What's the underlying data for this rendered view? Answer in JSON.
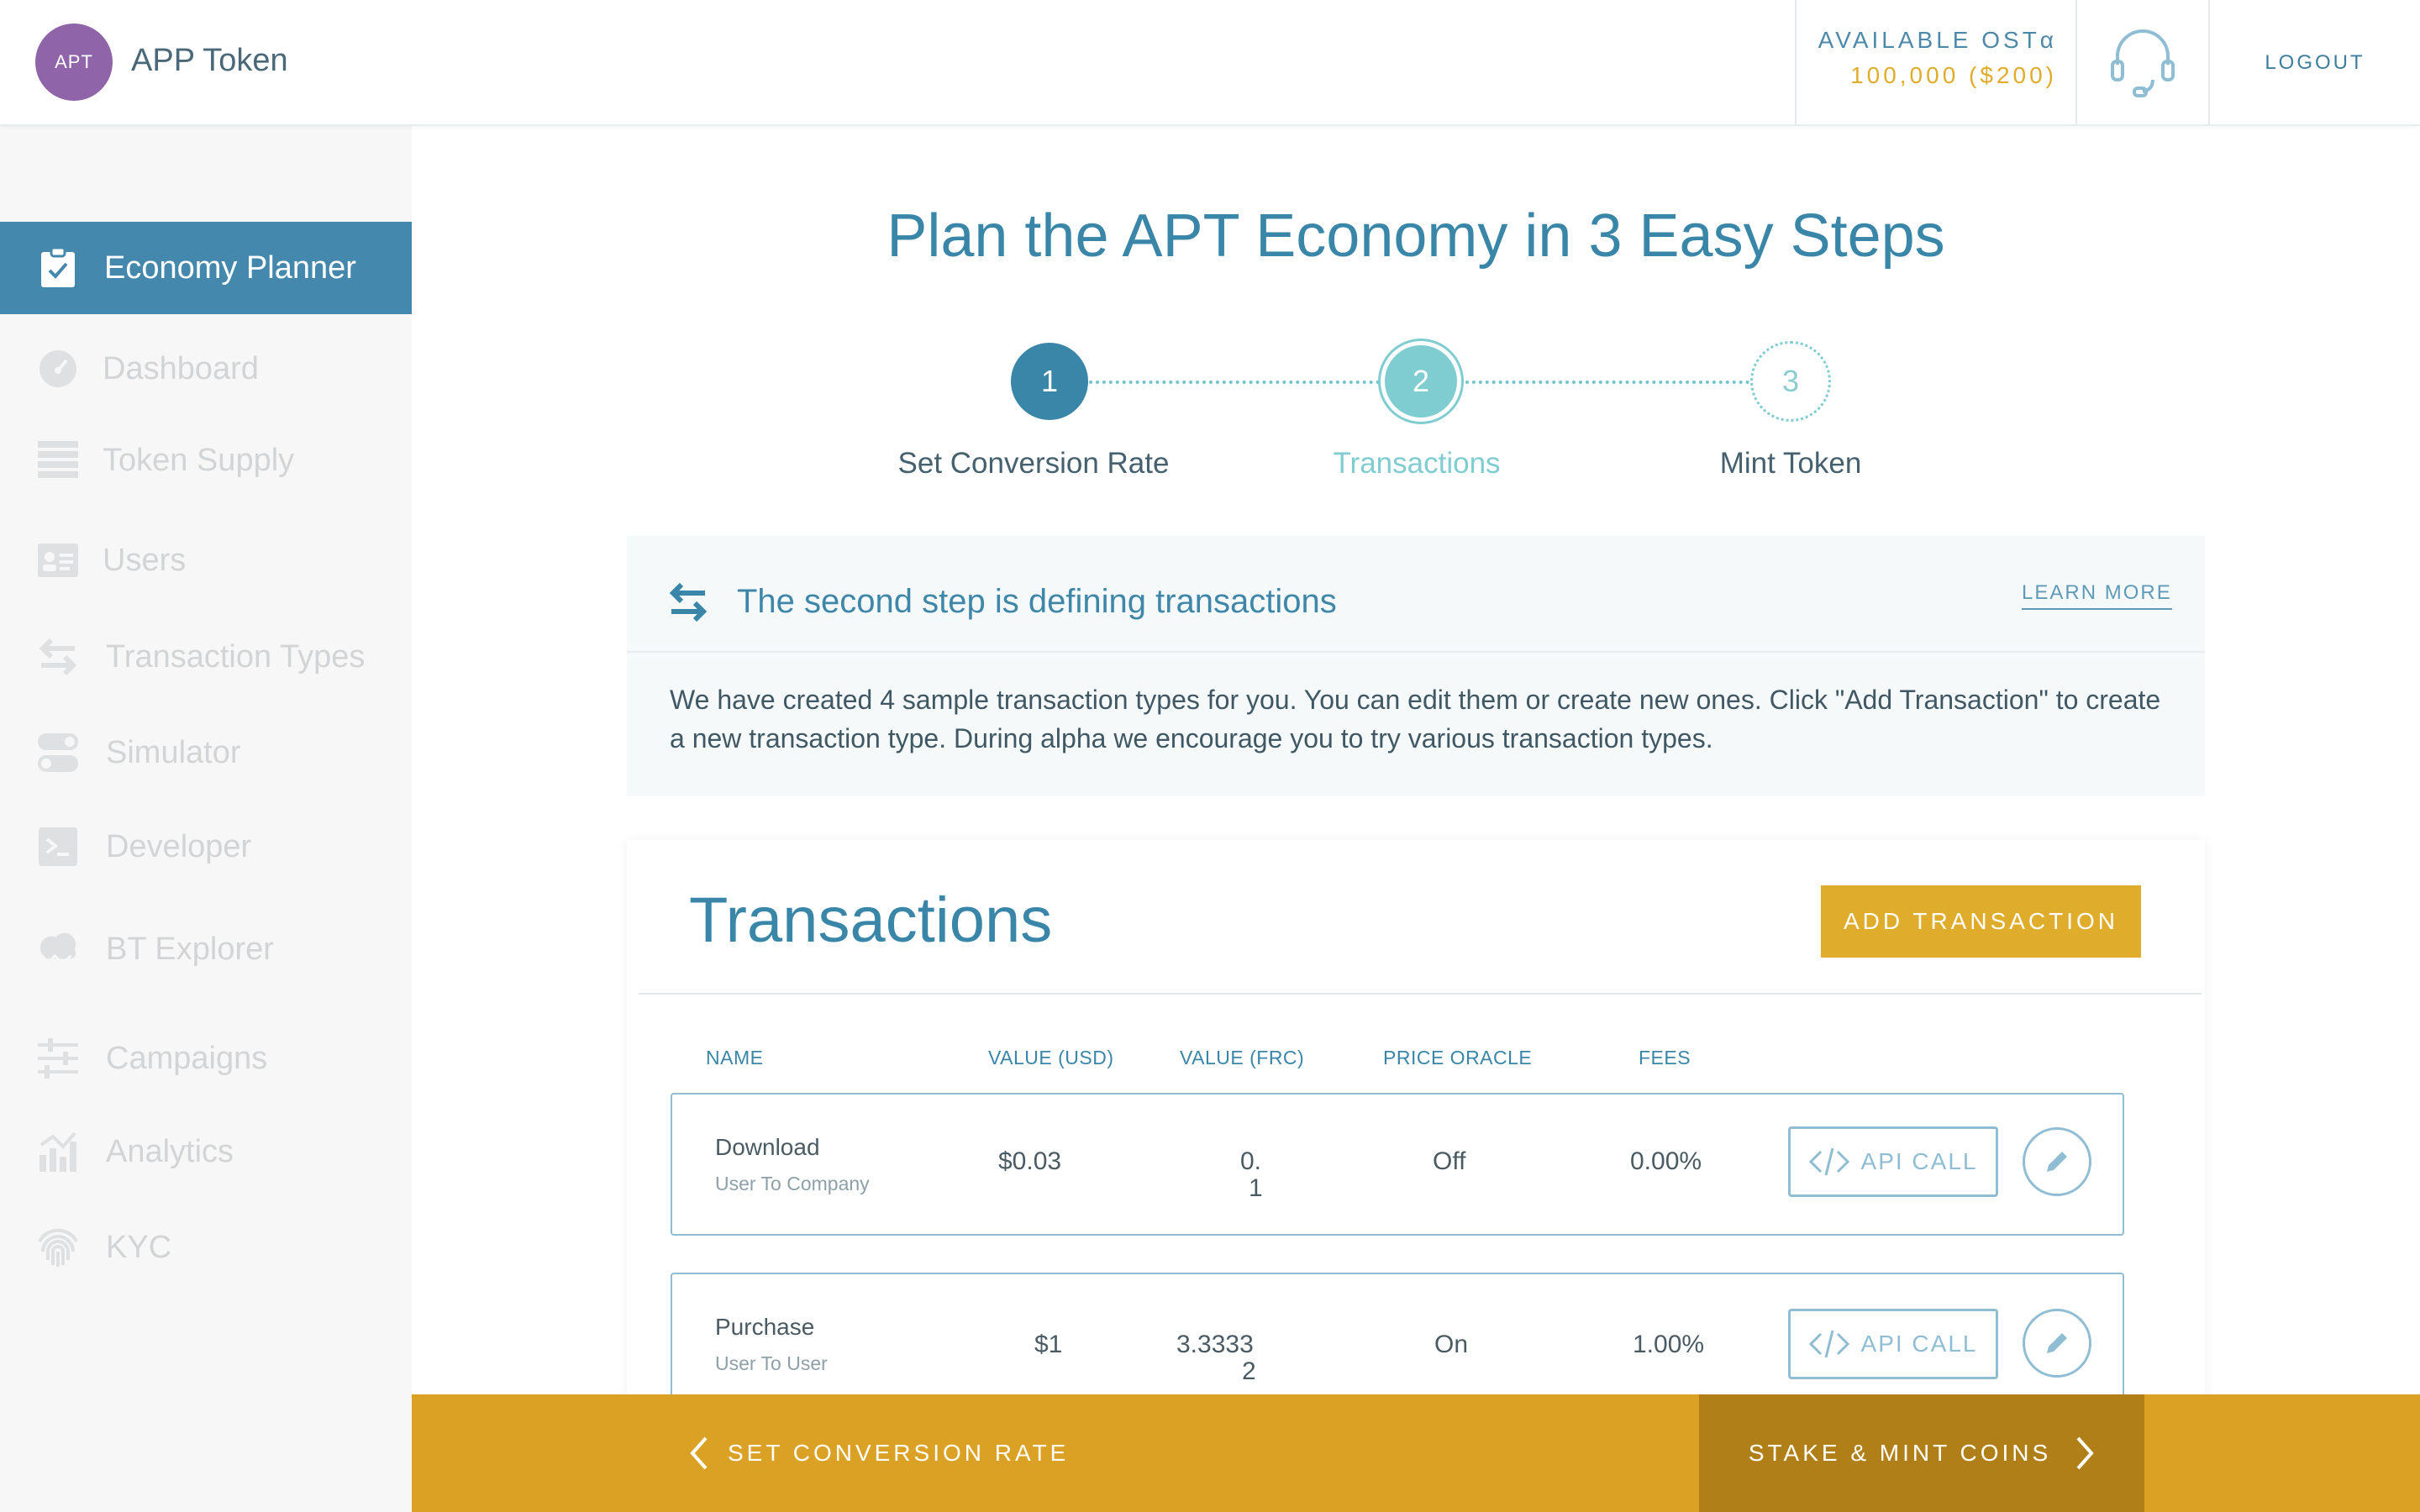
{
  "header": {
    "logo_text": "APT",
    "app_name": "APP Token",
    "balance_label": "AVAILABLE OSTα",
    "balance_value": "100,000 ($200)",
    "support_icon": "headset-icon",
    "logout_label": "LOGOUT"
  },
  "sidebar": {
    "items": [
      {
        "label": "Economy Planner",
        "icon": "clipboard-check-icon",
        "active": true
      },
      {
        "label": "Dashboard",
        "icon": "gauge-icon"
      },
      {
        "label": "Token Supply",
        "icon": "stack-icon"
      },
      {
        "label": "Users",
        "icon": "id-card-icon"
      },
      {
        "label": "Transaction Types",
        "icon": "transfer-arrows-icon"
      },
      {
        "label": "Simulator",
        "icon": "toggles-icon"
      },
      {
        "label": "Developer",
        "icon": "terminal-icon"
      },
      {
        "label": "BT Explorer",
        "icon": "cloud-network-icon"
      },
      {
        "label": "Campaigns",
        "icon": "sliders-icon"
      },
      {
        "label": "Analytics",
        "icon": "chart-icon"
      },
      {
        "label": "KYC",
        "icon": "fingerprint-icon"
      }
    ]
  },
  "main": {
    "title": "Plan the APT Economy in 3 Easy Steps",
    "steps": [
      {
        "number": "1",
        "label": "Set Conversion Rate",
        "state": "done"
      },
      {
        "number": "2",
        "label": "Transactions",
        "state": "current"
      },
      {
        "number": "3",
        "label": "Mint Token",
        "state": "upcoming"
      }
    ],
    "info": {
      "title": "The second step is defining transactions",
      "learn_more": "LEARN MORE",
      "text": "We have created 4 sample transaction types for you. You can edit them or create new ones. Click \"Add Transaction\" to create a new transaction type. During alpha we encourage you to try various transaction types."
    },
    "transactions": {
      "title": "Transactions",
      "add_button": "ADD TRANSACTION",
      "columns": [
        "NAME",
        "VALUE (USD)",
        "VALUE (FRC)",
        "PRICE ORACLE",
        "FEES"
      ],
      "rows": [
        {
          "name": "Download",
          "kind": "User To Company",
          "usd": "$0.03",
          "frc_line1": "0.",
          "frc_line2": "1",
          "oracle": "Off",
          "fees": "0.00%"
        },
        {
          "name": "Purchase",
          "kind": "User To User",
          "usd": "$1",
          "frc_line1": "3.3333",
          "frc_line2": "2",
          "oracle": "On",
          "fees": "1.00%"
        }
      ],
      "api_button": "API CALL"
    }
  },
  "footer": {
    "prev_label": "SET CONVERSION RATE",
    "next_label": "STAKE & MINT COINS"
  },
  "colors": {
    "primary": "#3a86a8",
    "accent": "#e0ac2b",
    "teal": "#6fc6cc",
    "logo": "#9064a8"
  }
}
